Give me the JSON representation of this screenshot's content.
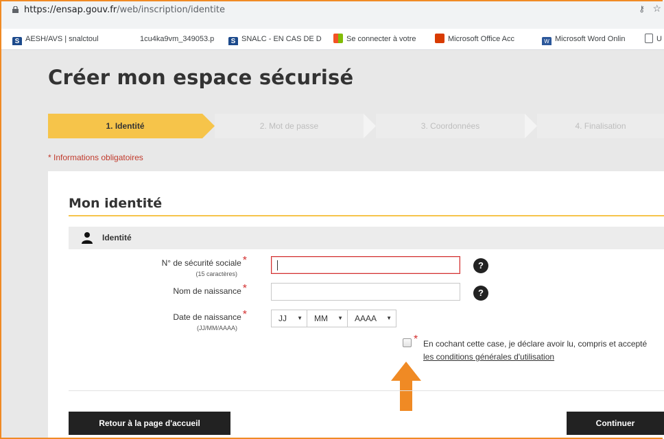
{
  "browser": {
    "url_host": "https://ensap.gouv.fr",
    "url_path": "/web/inscription/identite",
    "bookmarks": [
      {
        "label": "AESH/AVS | snalctoul",
        "icon": "snalc-icon"
      },
      {
        "label": "1cu4ka9vm_349053.p",
        "icon": "none"
      },
      {
        "label": "SNALC - EN CAS DE D",
        "icon": "snalc-icon"
      },
      {
        "label": "Se connecter à votre",
        "icon": "microsoft-icon"
      },
      {
        "label": "Microsoft Office Acc",
        "icon": "office-icon"
      },
      {
        "label": "Microsoft Word Onlin",
        "icon": "word-icon"
      },
      {
        "label": "U",
        "icon": "document-icon"
      }
    ]
  },
  "page": {
    "title": "Créer mon espace sécurisé",
    "steps": [
      "1. Identité",
      "2. Mot de passe",
      "3. Coordonnées",
      "4. Finalisation"
    ],
    "active_step": 0,
    "required_note": "* Informations obligatoires"
  },
  "form": {
    "title": "Mon identité",
    "section": "Identité",
    "ssn_label": "N° de sécurité sociale",
    "ssn_hint": "(15 caractères)",
    "ssn_value": "",
    "birthname_label": "Nom de naissance",
    "birthname_value": "",
    "birthdate_label": "Date de naissance",
    "birthdate_hint": "(JJ/MM/AAAA)",
    "day_selected": "JJ",
    "month_selected": "MM",
    "year_selected": "AAAA",
    "required_mark": "*",
    "help_mark": "?",
    "cgu_text": "En cochant cette case, je déclare avoir lu, compris et accepté",
    "cgu_link": "les conditions générales d'utilisation",
    "cgu_checked": false
  },
  "actions": {
    "back": "Retour à la page d'accueil",
    "continue": "Continuer"
  },
  "colors": {
    "accent": "#f6c44a",
    "required": "#d32f2f",
    "annotation_arrow": "#f08a24"
  }
}
